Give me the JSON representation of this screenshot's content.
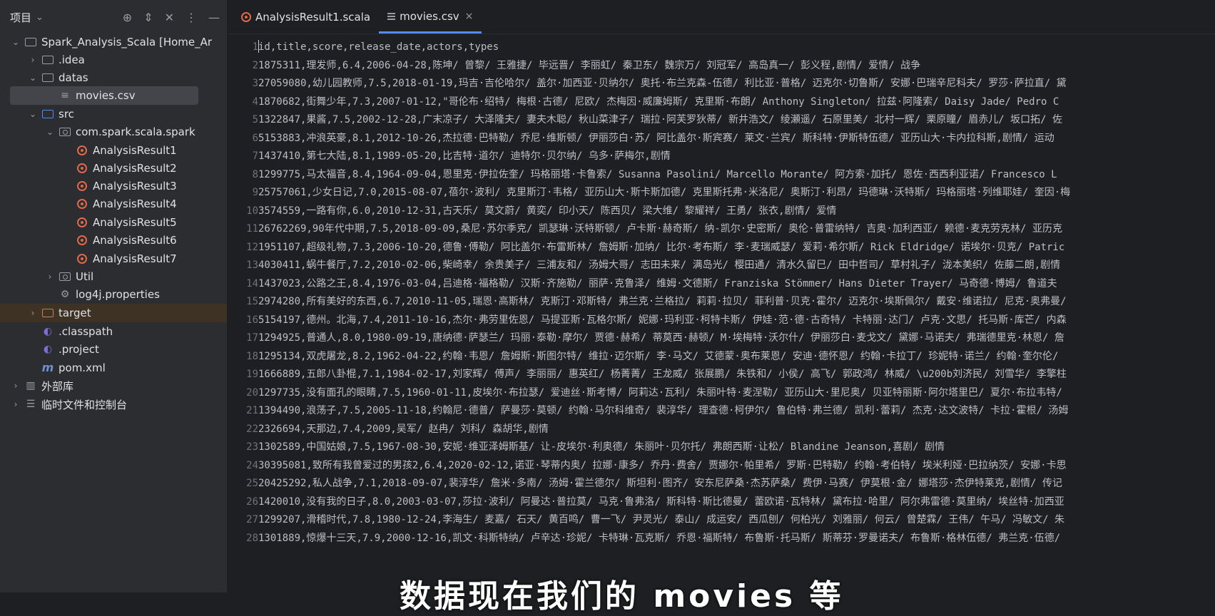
{
  "sidebar": {
    "title": "项目",
    "title_chevron": "⌄",
    "tools": [
      "⊕",
      "⇕",
      "✕",
      "⋮",
      "—"
    ],
    "items": [
      {
        "label": "Spark_Analysis_Scala [Home_Ar",
        "depth": 0,
        "arrow": "⌄",
        "icon": "folder-icon"
      },
      {
        "label": ".idea",
        "depth": 1,
        "arrow": "›",
        "icon": "folder-icon"
      },
      {
        "label": "datas",
        "depth": 1,
        "arrow": "⌄",
        "icon": "folder-icon"
      },
      {
        "label": "movies.csv",
        "depth": 2,
        "arrow": "",
        "icon": "csv-file-icon"
      },
      {
        "label": "src",
        "depth": 1,
        "arrow": "⌄",
        "icon": "source-folder-icon"
      },
      {
        "label": "com.spark.scala.spark",
        "depth": 2,
        "arrow": "⌄",
        "icon": "package-icon"
      },
      {
        "label": "AnalysisResult1",
        "depth": 3,
        "arrow": "",
        "icon": "scala-object-icon"
      },
      {
        "label": "AnalysisResult2",
        "depth": 3,
        "arrow": "",
        "icon": "scala-object-icon"
      },
      {
        "label": "AnalysisResult3",
        "depth": 3,
        "arrow": "",
        "icon": "scala-object-icon"
      },
      {
        "label": "AnalysisResult4",
        "depth": 3,
        "arrow": "",
        "icon": "scala-object-icon"
      },
      {
        "label": "AnalysisResult5",
        "depth": 3,
        "arrow": "",
        "icon": "scala-object-icon"
      },
      {
        "label": "AnalysisResult6",
        "depth": 3,
        "arrow": "",
        "icon": "scala-object-icon"
      },
      {
        "label": "AnalysisResult7",
        "depth": 3,
        "arrow": "",
        "icon": "scala-object-icon"
      },
      {
        "label": "Util",
        "depth": 2,
        "arrow": "›",
        "icon": "package-icon"
      },
      {
        "label": "log4j.properties",
        "depth": 2,
        "arrow": "",
        "icon": "gear-icon"
      },
      {
        "label": "target",
        "depth": 1,
        "arrow": "›",
        "icon": "excluded-folder-icon"
      },
      {
        "label": ".classpath",
        "depth": 1,
        "arrow": "",
        "icon": "eclipse-file-icon"
      },
      {
        "label": ".project",
        "depth": 1,
        "arrow": "",
        "icon": "eclipse-file-icon"
      },
      {
        "label": "pom.xml",
        "depth": 1,
        "arrow": "",
        "icon": "maven-icon"
      },
      {
        "label": "外部库",
        "depth": 0,
        "arrow": "›",
        "icon": "library-icon"
      },
      {
        "label": "临时文件和控制台",
        "depth": 0,
        "arrow": "›",
        "icon": "scratch-icon"
      }
    ]
  },
  "tabs": [
    {
      "label": "AnalysisResult1.scala",
      "active": false,
      "icon": "scala-object-icon"
    },
    {
      "label": "movies.csv",
      "active": true,
      "icon": "csv-file-icon",
      "close": "×"
    }
  ],
  "editor": {
    "lines": [
      "id,title,score,release_date,actors,types",
      "1875311,理发师,6.4,2006-04-28,陈坤/ 曾黎/ 王雅捷/ 毕远晋/ 李丽虹/ 秦卫东/ 魏宗万/ 刘冠军/ 高岛真一/ 彭义程,剧情/ 爱情/ 战争",
      "27059080,幼儿园教师,7.5,2018-01-19,玛吉·吉伦哈尔/ 盖尔·加西亚·贝纳尔/ 奥托·布兰克森-伍德/ 利比亚·普格/ 迈克尔·切鲁斯/ 安娜·巴瑞辛尼科夫/ 罗莎·萨拉直/ 黛",
      "1870682,街舞少年,7.3,2007-01-12,\"哥伦布·绍特/ 梅根·古德/ 尼欧/ 杰梅因·威廉姆斯/ 克里斯·布朗/ Anthony Singleton/ 拉兹·阿隆索/ Daisy Jade/ Pedro C",
      "1322847,果酱,7.5,2002-12-28,广末凉子/ 大泽隆夫/ 妻夫木聪/ 秋山菜津子/ 瑞拉·阿芙罗狄蒂/ 新井浩文/ 绫瀬遥/ 石原里美/ 北村一辉/ 栗原瞳/ 眉赤儿/ 坂口拓/ 佐",
      "5153883,冲浪英豪,8.1,2012-10-26,杰拉德·巴特勒/ 乔尼·维斯顿/ 伊丽莎白·苏/ 阿比盖尔·斯宾赛/ 莱文·兰宾/ 斯科特·伊斯特伍德/ 亚历山大·卡内拉科斯,剧情/ 运动",
      "1437410,第七大陆,8.1,1989-05-20,比吉特·道尔/ 迪特尔·贝尔纳/ 乌多·萨梅尔,剧情",
      "1299775,马太福音,8.4,1964-09-04,恩里克·伊拉佐奎/ 玛格丽塔·卡鲁索/ Susanna Pasolini/ Marcello Morante/ 阿方索·加托/ 恩佐·西西利亚诺/ Francesco L",
      "25757061,少女日记,7.0,2015-08-07,蓓尔·波利/ 克里斯汀·韦格/ 亚历山大·斯卡斯加德/ 克里斯托弗·米洛尼/ 奥斯汀·利昂/ 玛德琳·沃特斯/ 玛格丽塔·列维耶娃/ 奎因·梅",
      "3574559,一路有你,6.0,2010-12-31,古天乐/ 莫文蔚/ 黄奕/ 印小天/ 陈西贝/ 梁大维/ 黎耀祥/ 王勇/ 张衣,剧情/ 爱情",
      "26762269,90年代中期,7.5,2018-09-09,桑尼·苏尔季克/ 凯瑟琳·沃特斯顿/ 卢卡斯·赫奇斯/ 纳-凯尔·史密斯/ 奥伦·普雷纳特/ 吉奥·加利西亚/ 赖德·麦克劳克林/ 亚历克",
      "1951107,超级礼物,7.3,2006-10-20,德鲁·傅勒/ 阿比盖尔·布雷斯林/ 詹姆斯·加纳/ 比尔·考布斯/ 李·麦瑞威瑟/ 爱莉·希尔斯/ Rick Eldridge/ 诺埃尔·贝克/ Patric",
      "4030411,蜗牛餐厅,7.2,2010-02-06,柴崎幸/ 余贵美子/ 三浦友和/ 汤姆大哥/ 志田未来/ 满岛光/ 樱田通/ 清水久留巳/ 田中哲司/ 草村礼子/ 泷本美织/ 佐藤二朗,剧情",
      "1437023,公路之王,8.4,1976-03-04,吕迪格·福格勒/ 汉斯·齐施勒/ 丽萨·克鲁泽/ 维姆·文德斯/ Franziska Stömmer/ Hans Dieter Trayer/ 马奇德·博姆/ 鲁道夫",
      "2974280,所有美好的东西,6.7,2010-11-05,瑞恩·高斯林/ 克斯汀·邓斯特/ 弗兰克·兰格拉/ 莉莉·拉贝/ 菲利普·贝克·霍尔/ 迈克尔·埃斯佩尔/ 戴安·维诺拉/ 尼克·奥弗曼/",
      "5154197,德州。北海,7.4,2011-10-16,杰尔·弗劳里佐恩/ 马提亚斯·瓦格尔斯/ 妮娜·玛利亚·柯特卡斯/ 伊娃·范·德·古奇特/ 卡特丽·达门/ 卢克·文思/ 托马斯·库芒/ 内森",
      "1294925,普通人,8.0,1980-09-19,唐纳德·萨瑟兰/ 玛丽·泰勒·摩尔/ 贾德·赫希/ 蒂莫西·赫顿/ M·埃梅特·沃尔什/ 伊丽莎白·麦戈文/ 黛娜·马诺夫/ 弗瑞德里克·林恩/ 詹",
      "1295134,双虎屠龙,8.2,1962-04-22,约翰·韦恩/ 詹姆斯·斯图尔特/ 维拉·迈尔斯/ 李·马文/ 艾德蒙·奥布莱恩/ 安迪·德怀恩/ 约翰·卡拉丁/ 珍妮特·诺兰/ 约翰·奎尔伦/",
      "1666889,五郎八卦棍,7.1,1984-02-17,刘家辉/ 傅声/ 李丽丽/ 惠英红/ 杨菁菁/ 王龙威/ 张展鹏/ 朱铁和/ 小侯/ 高飞/ 郭政鸿/ 林威/ \\u200b刘济民/ 刘雪华/ 李擎柱",
      "1297735,没有面孔的眼睛,7.5,1960-01-11,皮埃尔·布拉瑟/ 爱迪丝·斯考博/ 阿莉达·瓦利/ 朱丽叶特·麦涅勒/ 亚历山大·里尼奥/ 贝亚特丽斯·阿尔塔里巴/ 夏尔·布拉韦特/",
      "1394490,浪荡子,7.5,2005-11-18,约翰尼·德普/ 萨曼莎·莫顿/ 约翰·马尔科维奇/ 裴淳华/ 理查德·柯伊尔/ 鲁伯特·弗兰德/ 凯利·蕾莉/ 杰克·达文波特/ 卡拉·霍根/ 汤姆",
      "2326694,天那边,7.4,2009,吴军/ 赵冉/ 刘科/ 森胡华,剧情",
      "1302589,中国姑娘,7.5,1967-08-30,安妮·维亚泽姆斯基/ 让-皮埃尔·利奥德/ 朱丽叶·贝尔托/ 弗朗西斯·让松/ Blandine Jeanson,喜剧/ 剧情",
      "30395081,致所有我曾爱过的男孩2,6.4,2020-02-12,诺亚·琴蒂内奥/ 拉娜·康多/ 乔丹·费舍/ 贾娜尔·帕里希/ 罗斯·巴特勒/ 约翰·考伯特/ 埃米利娅·巴拉纳茨/ 安娜·卡思",
      "20425292,私人战争,7.1,2018-09-07,裴淳华/ 詹米·多南/ 汤姆·霍兰德尔/ 斯坦利·图齐/ 安东尼萨桑·杰苏萨桑/ 费伊·马赛/ 伊莫根·金/ 娜塔莎·杰伊特莱克,剧情/ 传记",
      "1420010,没有我的日子,8.0,2003-03-07,莎拉·波利/ 阿曼达·普拉莫/ 马克·鲁弗洛/ 斯科特·斯比德曼/ 蕾欧诺·瓦特林/ 黛布拉·哈里/ 阿尔弗雷德·莫里纳/ 埃丝特·加西亚",
      "1299207,滑稽时代,7.8,1980-12-24,李海生/ 麦嘉/ 石天/ 黄百鸣/ 曹一飞/ 尹灵光/ 泰山/ 成运安/ 西瓜刨/ 何柏光/ 刘雅丽/ 何云/ 曾楚霖/ 王伟/ 午马/ 冯敏文/ 朱",
      "1301889,惊爆十三天,7.9,2000-12-16,凯文·科斯特纳/ 卢辛达·珍妮/ 卡特琳·瓦克斯/ 乔恩·福斯特/ 布鲁斯·托马斯/ 斯蒂芬·罗曼诺夫/ 布鲁斯·格林伍德/ 弗兰克·伍德/"
    ]
  },
  "subtitle": "数据现在我们的 movies 等"
}
